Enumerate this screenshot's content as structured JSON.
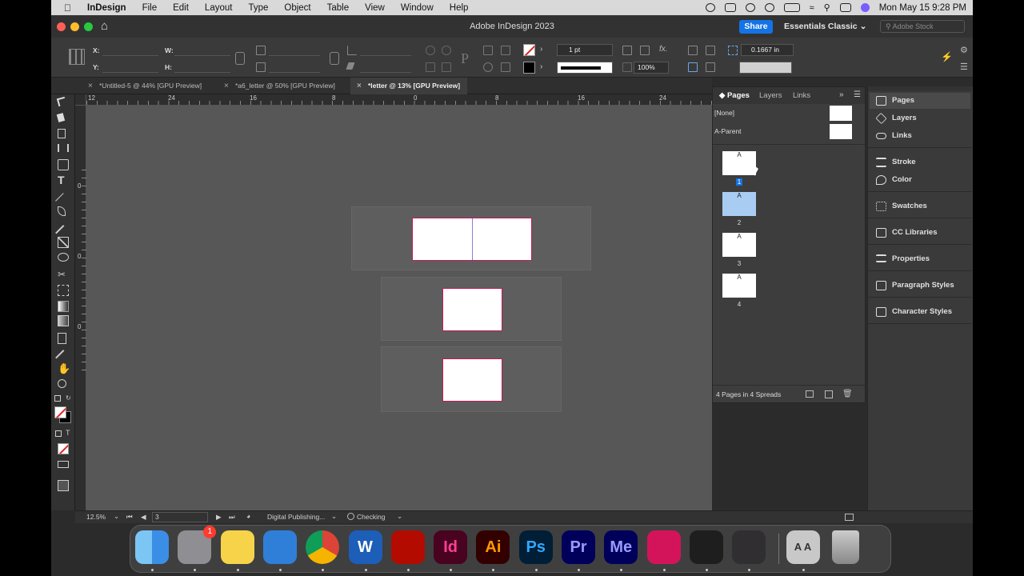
{
  "menubar": {
    "app_name": "InDesign",
    "menus": [
      "File",
      "Edit",
      "Layout",
      "Type",
      "Object",
      "Table",
      "View",
      "Window",
      "Help"
    ],
    "clock": "Mon May 15  9:28 PM"
  },
  "titlebar": {
    "title": "Adobe InDesign 2023",
    "share_label": "Share",
    "workspace": "Essentials Classic",
    "search_placeholder": "Adobe Stock"
  },
  "control": {
    "x_label": "X:",
    "y_label": "Y:",
    "w_label": "W:",
    "h_label": "H:",
    "stroke_weight": "1 pt",
    "opacity": "100%",
    "offset": "0.1667 in"
  },
  "tabs": [
    {
      "label": "*Untitled-5 @ 44% [GPU Preview]"
    },
    {
      "label": "*a6_letter @ 50% [GPU Preview]"
    },
    {
      "label": "*letter @ 13% [GPU Preview]"
    }
  ],
  "ruler": {
    "h_ticks": [
      "12",
      "24",
      "16",
      "8",
      "0",
      "8",
      "16",
      "24"
    ],
    "v_ticks": [
      "0",
      "0",
      "0"
    ]
  },
  "status": {
    "zoom": "12.5%",
    "page": "3",
    "profile": "Digital Publishing...",
    "preflight": "Checking"
  },
  "pages_panel": {
    "tabs": [
      "Pages",
      "Layers",
      "Links"
    ],
    "parents": [
      "[None]",
      "A-Parent"
    ],
    "pages": [
      {
        "number": "1",
        "parent": "A"
      },
      {
        "number": "2",
        "parent": "A"
      },
      {
        "number": "3",
        "parent": "A"
      },
      {
        "number": "4",
        "parent": "A"
      }
    ],
    "summary": "4 Pages in 4 Spreads"
  },
  "dock_panels": [
    "Pages",
    "Layers",
    "Links",
    "Stroke",
    "Color",
    "Swatches",
    "CC Libraries",
    "Properties",
    "Paragraph Styles",
    "Character Styles"
  ],
  "macdock": {
    "apps": [
      {
        "name": "Finder",
        "label": "",
        "color": "#3a8ee6"
      },
      {
        "name": "System Settings",
        "label": "",
        "color": "#8e8e93",
        "badge": "1"
      },
      {
        "name": "Notes",
        "label": "",
        "color": "#f7d34a"
      },
      {
        "name": "Keynote",
        "label": "",
        "color": "#2f7fd8"
      },
      {
        "name": "Chrome",
        "label": "",
        "color": "#e0e0e0"
      },
      {
        "name": "Word",
        "label": "W",
        "color": "#1d5eb8"
      },
      {
        "name": "Acrobat",
        "label": "",
        "color": "#b30b00"
      },
      {
        "name": "InDesign",
        "label": "Id",
        "color": "#49021f"
      },
      {
        "name": "Illustrator",
        "label": "Ai",
        "color": "#330000"
      },
      {
        "name": "Photoshop",
        "label": "Ps",
        "color": "#001e36"
      },
      {
        "name": "Premiere Pro",
        "label": "Pr",
        "color": "#00005b"
      },
      {
        "name": "Media Encoder",
        "label": "Me",
        "color": "#00005b"
      },
      {
        "name": "Creative Cloud",
        "label": "",
        "color": "#d4145a"
      },
      {
        "name": "Figma",
        "label": "",
        "color": "#1e1e1e"
      },
      {
        "name": "OBS",
        "label": "",
        "color": "#302e31"
      },
      {
        "name": "Font Book",
        "label": "A A",
        "color": "#c8c8c8"
      },
      {
        "name": "Trash",
        "label": "",
        "color": "#9a9a9a"
      }
    ]
  }
}
